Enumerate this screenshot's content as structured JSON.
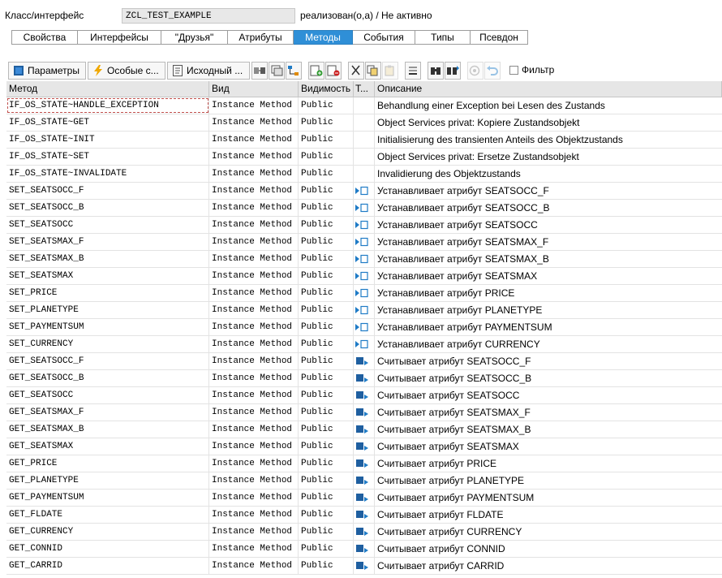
{
  "header": {
    "label": "Класс/интерфейс",
    "class_name": "ZCL_TEST_EXAMPLE",
    "status": "реализован(о,а) / Не активно"
  },
  "tabs": [
    {
      "label": "Свойства",
      "active": false
    },
    {
      "label": "Интерфейсы",
      "active": false
    },
    {
      "label": "\"Друзья\"",
      "active": false
    },
    {
      "label": "Атрибуты",
      "active": false
    },
    {
      "label": "Методы",
      "active": true
    },
    {
      "label": "События",
      "active": false
    },
    {
      "label": "Типы",
      "active": false
    },
    {
      "label": "Псевдон",
      "active": false
    }
  ],
  "toolbar": {
    "params_label": "Параметры",
    "exceptions_label": "Особые с...",
    "source_label": "Исходный ...",
    "filter_label": "Фильтр",
    "icons": [
      "switch-view-icon",
      "list-icon",
      "hierarchy-icon",
      "insert-row-icon",
      "delete-row-icon",
      "cut-icon",
      "copy-icon",
      "paste-icon",
      "sort-icon",
      "find-icon",
      "find-next-icon",
      "where-used-icon",
      "undo-icon"
    ]
  },
  "columns": {
    "name": "Метод",
    "kind": "Вид",
    "visibility": "Видимость",
    "type": "Т...",
    "description": "Описание"
  },
  "rows": [
    {
      "name": "IF_OS_STATE~HANDLE_EXCEPTION",
      "kind": "Instance Method",
      "visibility": "Public",
      "type": "",
      "description": "Behandlung einer Exception bei Lesen des  Zustands"
    },
    {
      "name": "IF_OS_STATE~GET",
      "kind": "Instance Method",
      "visibility": "Public",
      "type": "",
      "description": "Object Services privat: Kopiere Zustandsobjekt"
    },
    {
      "name": "IF_OS_STATE~INIT",
      "kind": "Instance Method",
      "visibility": "Public",
      "type": "",
      "description": "Initialisierung des transienten Anteils des Objektzustands"
    },
    {
      "name": "IF_OS_STATE~SET",
      "kind": "Instance Method",
      "visibility": "Public",
      "type": "",
      "description": "Object Services privat: Ersetze Zustandsobjekt"
    },
    {
      "name": "IF_OS_STATE~INVALIDATE",
      "kind": "Instance Method",
      "visibility": "Public",
      "type": "",
      "description": "Invalidierung des Objektzustands"
    },
    {
      "name": "SET_SEATSOCC_F",
      "kind": "Instance Method",
      "visibility": "Public",
      "type": "setter",
      "description": "Устанавливает атрибут SEATSOCC_F"
    },
    {
      "name": "SET_SEATSOCC_B",
      "kind": "Instance Method",
      "visibility": "Public",
      "type": "setter",
      "description": "Устанавливает атрибут SEATSOCC_B"
    },
    {
      "name": "SET_SEATSOCC",
      "kind": "Instance Method",
      "visibility": "Public",
      "type": "setter",
      "description": "Устанавливает атрибут SEATSOCC"
    },
    {
      "name": "SET_SEATSMAX_F",
      "kind": "Instance Method",
      "visibility": "Public",
      "type": "setter",
      "description": "Устанавливает атрибут SEATSMAX_F"
    },
    {
      "name": "SET_SEATSMAX_B",
      "kind": "Instance Method",
      "visibility": "Public",
      "type": "setter",
      "description": "Устанавливает атрибут SEATSMAX_B"
    },
    {
      "name": "SET_SEATSMAX",
      "kind": "Instance Method",
      "visibility": "Public",
      "type": "setter",
      "description": "Устанавливает атрибут SEATSMAX"
    },
    {
      "name": "SET_PRICE",
      "kind": "Instance Method",
      "visibility": "Public",
      "type": "setter",
      "description": "Устанавливает атрибут PRICE"
    },
    {
      "name": "SET_PLANETYPE",
      "kind": "Instance Method",
      "visibility": "Public",
      "type": "setter",
      "description": "Устанавливает атрибут PLANETYPE"
    },
    {
      "name": "SET_PAYMENTSUM",
      "kind": "Instance Method",
      "visibility": "Public",
      "type": "setter",
      "description": "Устанавливает атрибут PAYMENTSUM"
    },
    {
      "name": "SET_CURRENCY",
      "kind": "Instance Method",
      "visibility": "Public",
      "type": "setter",
      "description": "Устанавливает атрибут CURRENCY"
    },
    {
      "name": "GET_SEATSOCC_F",
      "kind": "Instance Method",
      "visibility": "Public",
      "type": "getter",
      "description": "Считывает атрибут SEATSOCC_F"
    },
    {
      "name": "GET_SEATSOCC_B",
      "kind": "Instance Method",
      "visibility": "Public",
      "type": "getter",
      "description": "Считывает атрибут SEATSOCC_B"
    },
    {
      "name": "GET_SEATSOCC",
      "kind": "Instance Method",
      "visibility": "Public",
      "type": "getter",
      "description": "Считывает атрибут SEATSOCC"
    },
    {
      "name": "GET_SEATSMAX_F",
      "kind": "Instance Method",
      "visibility": "Public",
      "type": "getter",
      "description": "Считывает атрибут SEATSMAX_F"
    },
    {
      "name": "GET_SEATSMAX_B",
      "kind": "Instance Method",
      "visibility": "Public",
      "type": "getter",
      "description": "Считывает атрибут SEATSMAX_B"
    },
    {
      "name": "GET_SEATSMAX",
      "kind": "Instance Method",
      "visibility": "Public",
      "type": "getter",
      "description": "Считывает атрибут SEATSMAX"
    },
    {
      "name": "GET_PRICE",
      "kind": "Instance Method",
      "visibility": "Public",
      "type": "getter",
      "description": "Считывает атрибут PRICE"
    },
    {
      "name": "GET_PLANETYPE",
      "kind": "Instance Method",
      "visibility": "Public",
      "type": "getter",
      "description": "Считывает атрибут PLANETYPE"
    },
    {
      "name": "GET_PAYMENTSUM",
      "kind": "Instance Method",
      "visibility": "Public",
      "type": "getter",
      "description": "Считывает атрибут PAYMENTSUM"
    },
    {
      "name": "GET_FLDATE",
      "kind": "Instance Method",
      "visibility": "Public",
      "type": "getter",
      "description": "Считывает атрибут FLDATE"
    },
    {
      "name": "GET_CURRENCY",
      "kind": "Instance Method",
      "visibility": "Public",
      "type": "getter",
      "description": "Считывает атрибут CURRENCY"
    },
    {
      "name": "GET_CONNID",
      "kind": "Instance Method",
      "visibility": "Public",
      "type": "getter",
      "description": "Считывает атрибут CONNID"
    },
    {
      "name": "GET_CARRID",
      "kind": "Instance Method",
      "visibility": "Public",
      "type": "getter",
      "description": "Считывает атрибут CARRID"
    }
  ],
  "colors": {
    "tab_active": "#2f8fd7",
    "header_bg": "#e6e6e6",
    "accent_blue": "#1f7bc6"
  }
}
